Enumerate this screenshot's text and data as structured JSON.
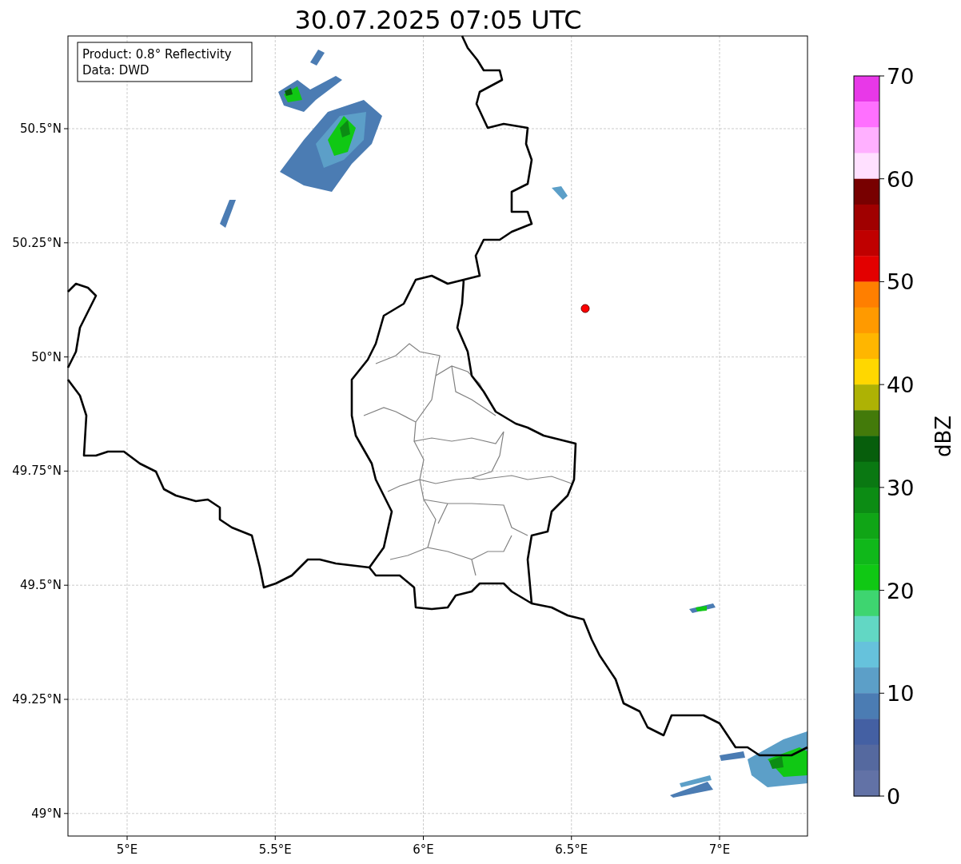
{
  "title": "30.07.2025 07:05 UTC",
  "info_box": [
    "Product: 0.8° Reflectivity",
    "Data: DWD"
  ],
  "x_ticks": [
    "5°E",
    "5.5°E",
    "6°E",
    "6.5°E",
    "7°E"
  ],
  "y_ticks": [
    "50.5°N",
    "50.25°N",
    "50°N",
    "49.75°N",
    "49.5°N",
    "49.25°N",
    "49°N"
  ],
  "colorbar": {
    "label": "dBZ",
    "ticks": [
      "70",
      "60",
      "50",
      "40",
      "30",
      "20",
      "10",
      "0"
    ],
    "bins": [
      {
        "color": "#e838e8"
      },
      {
        "color": "#ff70ff"
      },
      {
        "color": "#ffb0ff"
      },
      {
        "color": "#ffe0ff"
      },
      {
        "color": "#780000"
      },
      {
        "color": "#a00000"
      },
      {
        "color": "#c00000"
      },
      {
        "color": "#e30000"
      },
      {
        "color": "#ff7f00"
      },
      {
        "color": "#ff9a00"
      },
      {
        "color": "#ffb600"
      },
      {
        "color": "#ffd700"
      },
      {
        "color": "#aeb204"
      },
      {
        "color": "#437a0a"
      },
      {
        "color": "#075e0c"
      },
      {
        "color": "#0a7812"
      },
      {
        "color": "#0c8c14"
      },
      {
        "color": "#10a516"
      },
      {
        "color": "#10b81a"
      },
      {
        "color": "#10c814"
      },
      {
        "color": "#3ed570"
      },
      {
        "color": "#62d7c4"
      },
      {
        "color": "#66c2dc"
      },
      {
        "color": "#5c9fc8"
      },
      {
        "color": "#4b7cb3"
      },
      {
        "color": "#4460a3"
      },
      {
        "color": "#55699f"
      },
      {
        "color": "#6272a6"
      }
    ]
  }
}
